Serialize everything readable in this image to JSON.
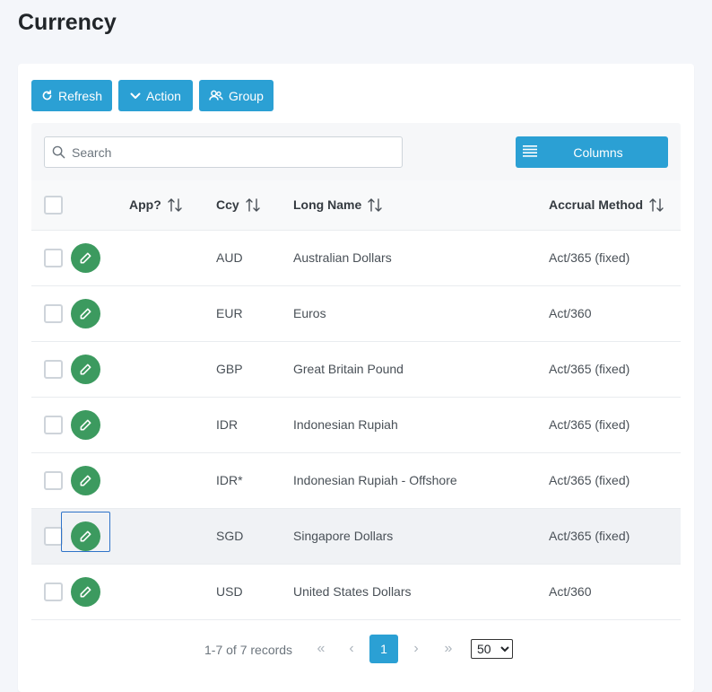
{
  "page": {
    "title": "Currency"
  },
  "toolbar": {
    "refresh": "Refresh",
    "action": "Action",
    "group": "Group"
  },
  "search": {
    "placeholder": "Search",
    "value": ""
  },
  "columns_button": "Columns",
  "table": {
    "headers": {
      "app": "App?",
      "ccy": "Ccy",
      "long_name": "Long Name",
      "accrual": "Accrual Method"
    },
    "rows": [
      {
        "ccy": "AUD",
        "long_name": "Australian Dollars",
        "accrual": "Act/365 (fixed)"
      },
      {
        "ccy": "EUR",
        "long_name": "Euros",
        "accrual": "Act/360"
      },
      {
        "ccy": "GBP",
        "long_name": "Great Britain Pound",
        "accrual": "Act/365 (fixed)"
      },
      {
        "ccy": "IDR",
        "long_name": "Indonesian Rupiah",
        "accrual": "Act/365 (fixed)"
      },
      {
        "ccy": "IDR*",
        "long_name": "Indonesian Rupiah - Offshore",
        "accrual": "Act/365 (fixed)"
      },
      {
        "ccy": "SGD",
        "long_name": "Singapore Dollars",
        "accrual": "Act/365 (fixed)"
      },
      {
        "ccy": "USD",
        "long_name": "United States Dollars",
        "accrual": "Act/360"
      }
    ]
  },
  "pagination": {
    "records_info": "1-7 of 7 records",
    "first": "«",
    "prev": "‹",
    "current_page": "1",
    "next": "›",
    "last": "»",
    "page_size": "50"
  },
  "colors": {
    "primary": "#2ba0d4",
    "edit": "#3c9a5f",
    "focus": "#2f73c9"
  }
}
